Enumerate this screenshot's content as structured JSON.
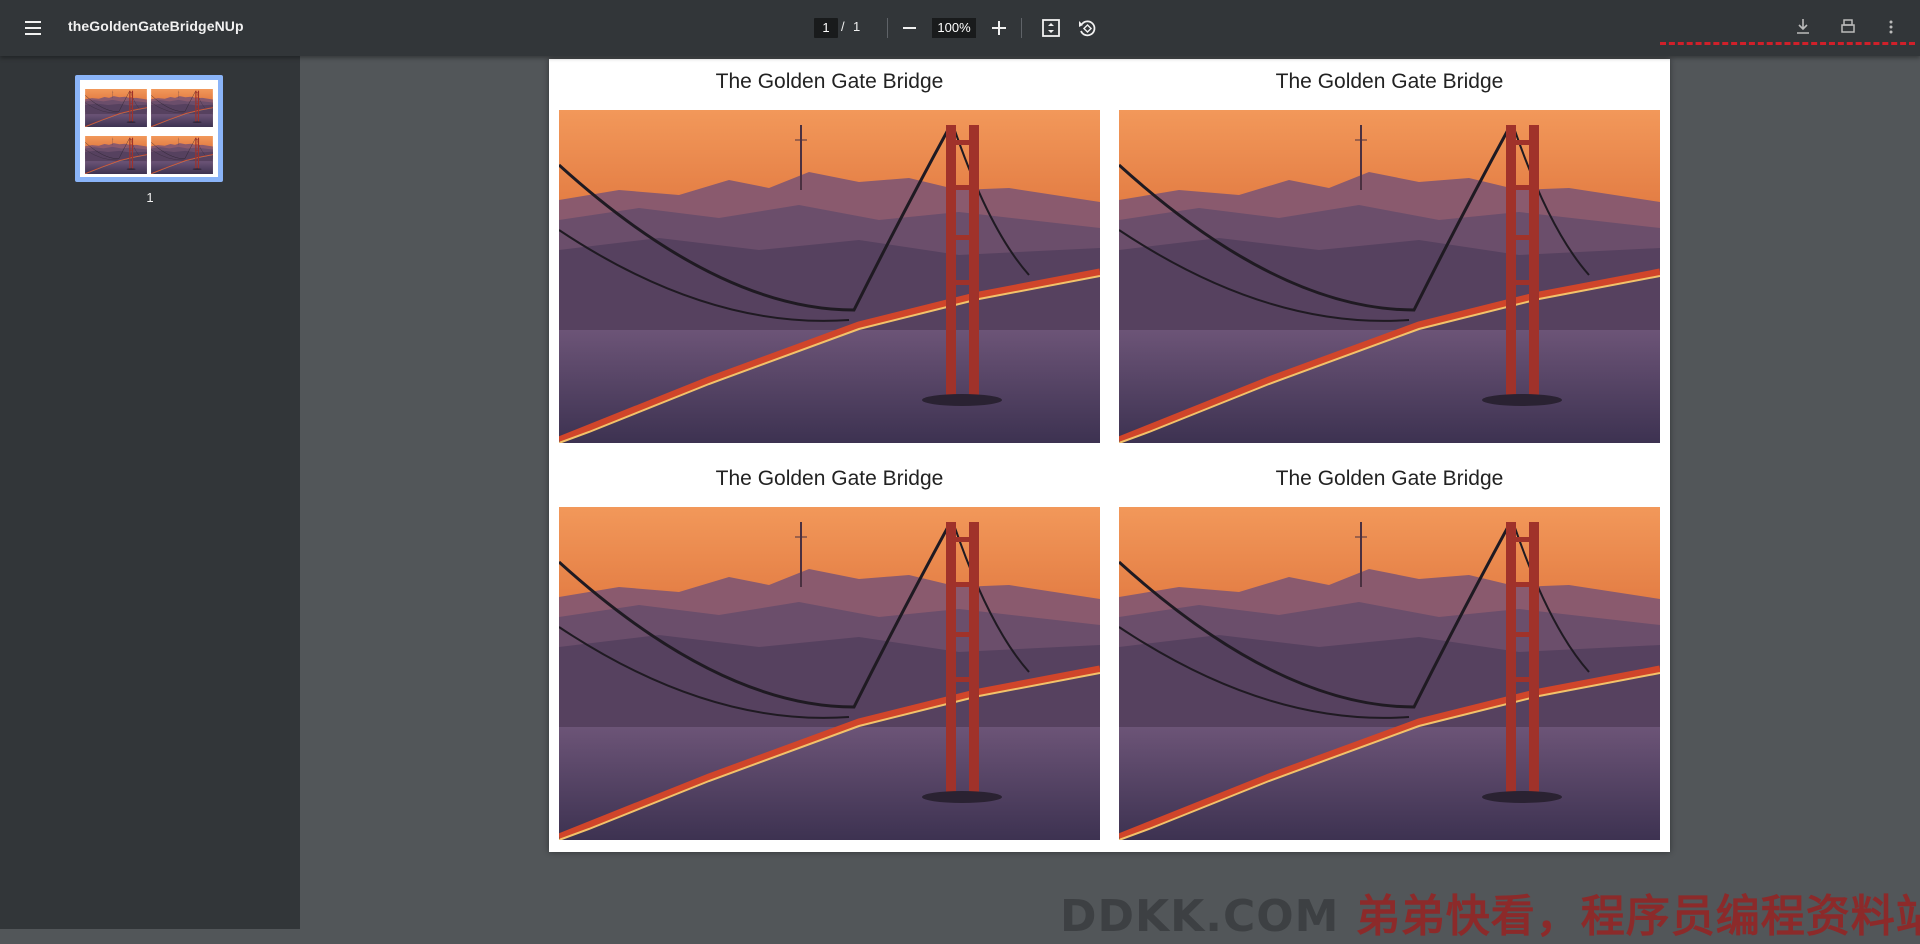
{
  "toolbar": {
    "title": "theGoldenGateBridgeNUp",
    "current_page": "1",
    "page_separator": "/",
    "total_pages": "1",
    "zoom": "100%"
  },
  "sidebar": {
    "thumbnails": [
      {
        "page_number": "1",
        "selected": true
      }
    ]
  },
  "page": {
    "cells": [
      {
        "title": "The Golden Gate Bridge"
      },
      {
        "title": "The Golden Gate Bridge"
      },
      {
        "title": "The Golden Gate Bridge"
      },
      {
        "title": "The Golden Gate Bridge"
      }
    ]
  },
  "watermark": {
    "text_latin": "DDKK.COM ",
    "text_cn": "弟弟快看，程序员编程资料站"
  },
  "colors": {
    "toolbar_bg": "#323639",
    "viewer_bg": "#525659",
    "thumb_selected": "#8ab4f8",
    "watermark_red": "#8c2a2a"
  }
}
